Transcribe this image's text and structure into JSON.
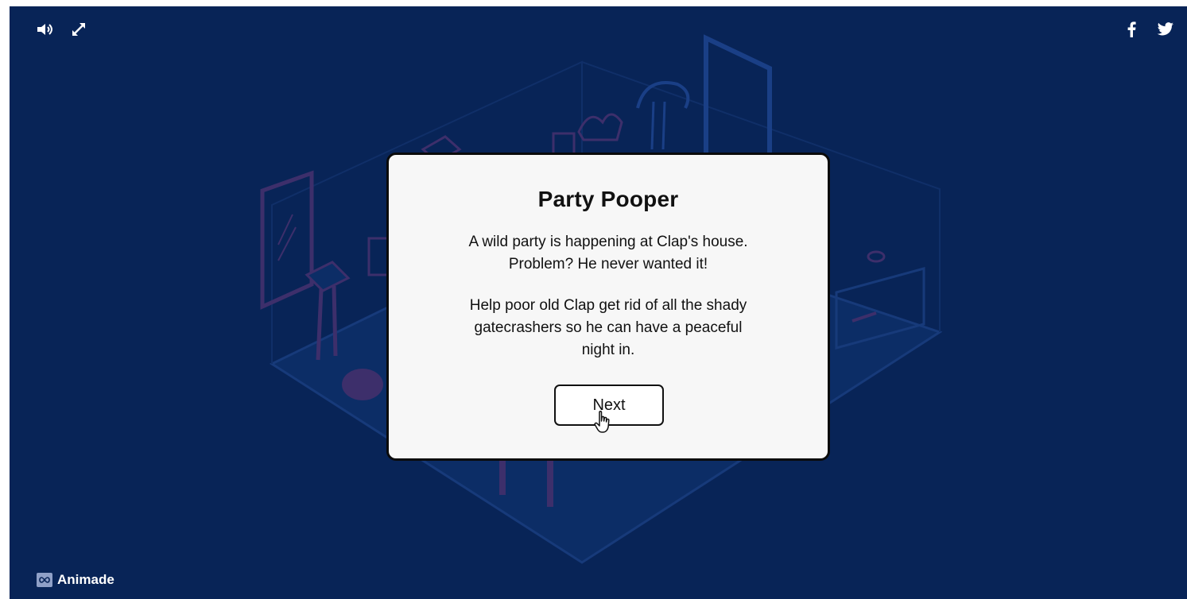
{
  "colors": {
    "background": "#082457",
    "scene_line": "#173a7a",
    "scene_fill": "#0c2d66",
    "dialog_background": "#f7f7f7",
    "dialog_border": "#0b0b0b",
    "accent_blue": "#1a3f86",
    "accent_purple": "#3d2f6b",
    "icon": "#ffffff"
  },
  "toolbar": {
    "sound_icon": "speaker-icon",
    "fullscreen_icon": "expand-icon",
    "facebook_icon": "facebook-icon",
    "twitter_icon": "twitter-icon"
  },
  "dialog": {
    "title": "Party Pooper",
    "paragraph1_line1": "A wild party is happening at Clap's house.",
    "paragraph1_line2": "Problem? He never wanted it!",
    "paragraph2_line1": "Help poor old Clap get rid of all the shady",
    "paragraph2_line2": "gatecrashers so he can have a peaceful",
    "paragraph2_line3": "night in.",
    "next_label": "Next"
  },
  "footer": {
    "brand_name": "Animade",
    "brand_icon": "infinity-logo-icon"
  }
}
